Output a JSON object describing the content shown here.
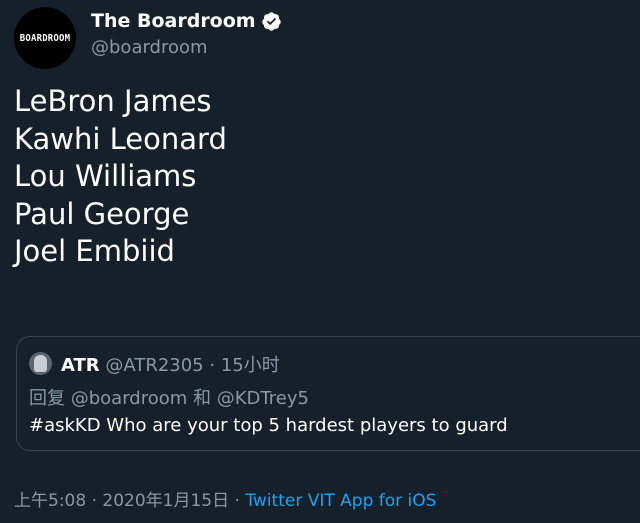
{
  "author": {
    "avatar_text": "BOARDROOM",
    "name": "The Boardroom",
    "handle": "@boardroom",
    "verified": true
  },
  "tweet_lines": [
    "LeBron James",
    "Kawhi Leonard",
    "Lou Williams",
    "Paul George",
    "Joel Embiid"
  ],
  "quoted": {
    "name": "ATR",
    "handle": "@ATR2305",
    "separator": "·",
    "time": "15小时",
    "reply_prefix": "回复",
    "reply_mention_1": "@boardroom",
    "reply_and": "和",
    "reply_mention_2": "@KDTrey5",
    "text": "#askKD Who are your top 5 hardest players to guard"
  },
  "footer": {
    "time": "上午5:08",
    "separator": "·",
    "date": "2020年1月15日",
    "source": "Twitter VIT App for iOS"
  },
  "colors": {
    "background": "#15202b",
    "text": "#ffffff",
    "secondary": "#8899a6",
    "link": "#1da1f2",
    "border": "#38444d"
  }
}
